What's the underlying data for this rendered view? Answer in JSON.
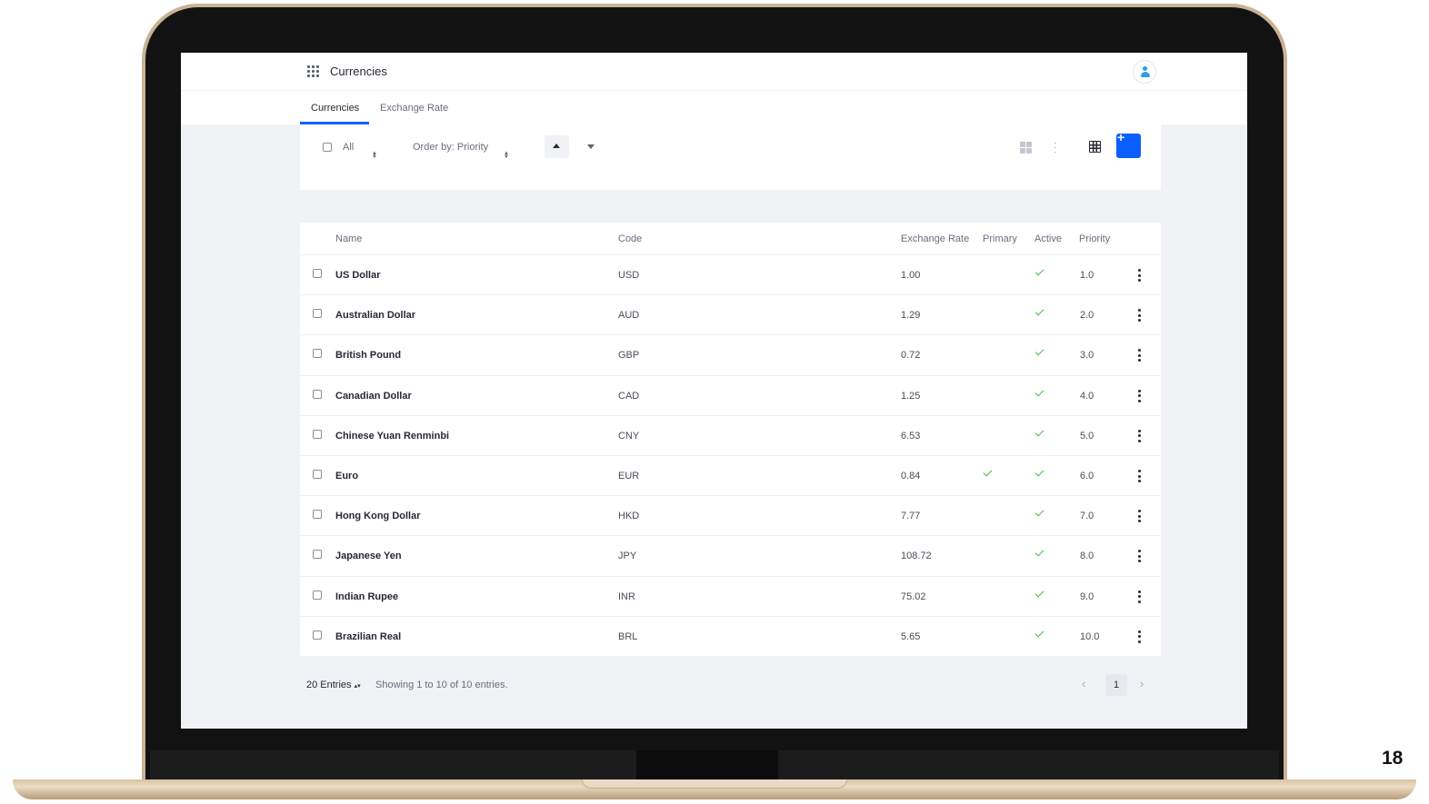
{
  "app": {
    "title": "Currencies"
  },
  "tabs": [
    {
      "label": "Currencies",
      "active": true
    },
    {
      "label": "Exchange Rate",
      "active": false
    }
  ],
  "toolbar": {
    "select_all_label": "All",
    "order_by_label": "Order by: Priority",
    "add_button_symbol": "+"
  },
  "table": {
    "columns": [
      "Name",
      "Code",
      "Exchange Rate",
      "Primary",
      "Active",
      "Priority"
    ],
    "rows": [
      {
        "name": "US Dollar",
        "code": "USD",
        "rate": "1.00",
        "primary": false,
        "active": true,
        "priority": "1.0"
      },
      {
        "name": "Australian Dollar",
        "code": "AUD",
        "rate": "1.29",
        "primary": false,
        "active": true,
        "priority": "2.0"
      },
      {
        "name": "British Pound",
        "code": "GBP",
        "rate": "0.72",
        "primary": false,
        "active": true,
        "priority": "3.0"
      },
      {
        "name": "Canadian Dollar",
        "code": "CAD",
        "rate": "1.25",
        "primary": false,
        "active": true,
        "priority": "4.0"
      },
      {
        "name": "Chinese Yuan Renminbi",
        "code": "CNY",
        "rate": "6.53",
        "primary": false,
        "active": true,
        "priority": "5.0"
      },
      {
        "name": "Euro",
        "code": "EUR",
        "rate": "0.84",
        "primary": true,
        "active": true,
        "priority": "6.0"
      },
      {
        "name": "Hong Kong Dollar",
        "code": "HKD",
        "rate": "7.77",
        "primary": false,
        "active": true,
        "priority": "7.0"
      },
      {
        "name": "Japanese Yen",
        "code": "JPY",
        "rate": "108.72",
        "primary": false,
        "active": true,
        "priority": "8.0"
      },
      {
        "name": "Indian Rupee",
        "code": "INR",
        "rate": "75.02",
        "primary": false,
        "active": true,
        "priority": "9.0"
      },
      {
        "name": "Brazilian Real",
        "code": "BRL",
        "rate": "5.65",
        "primary": false,
        "active": true,
        "priority": "10.0"
      }
    ]
  },
  "footer": {
    "entries_label": "20 Entries",
    "showing_text": "Showing 1 to 10 of 10 entries.",
    "current_page": "1"
  },
  "slide": {
    "number": "18"
  },
  "colors": {
    "accent": "#0b5fff",
    "check_green": "#4bb543",
    "avatar_blue": "#2e9be8"
  },
  "icons": [
    "apps-grid-icon",
    "user-avatar-icon",
    "card-view-icon",
    "list-view-icon",
    "table-view-icon",
    "plus-icon",
    "check-icon",
    "kebab-menu-icon",
    "chevron-left-icon",
    "chevron-right-icon"
  ]
}
